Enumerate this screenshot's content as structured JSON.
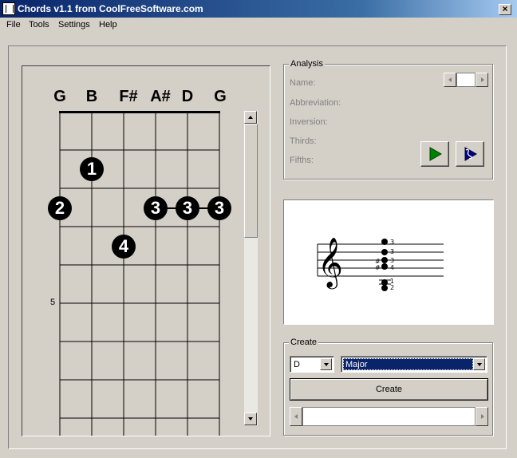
{
  "window": {
    "title": "Chords v1.1 from CoolFreeSoftware.com",
    "icon": "chord-app-icon",
    "close_glyph": "×"
  },
  "menu": [
    {
      "label": "File"
    },
    {
      "label": "Tools"
    },
    {
      "label": "Settings"
    },
    {
      "label": "Help"
    }
  ],
  "fretboard": {
    "strings": [
      "G",
      "B",
      "F#",
      "A#",
      "D",
      "G"
    ],
    "fret_marker": "5",
    "fingers": [
      {
        "string": 2,
        "fret": 2,
        "label": "1"
      },
      {
        "string": 1,
        "fret": 3,
        "label": "2"
      },
      {
        "string": 4,
        "fret": 3,
        "label": "3"
      },
      {
        "string": 5,
        "fret": 3,
        "label": "3"
      },
      {
        "string": 6,
        "fret": 3,
        "label": "3"
      },
      {
        "string": 3,
        "fret": 4,
        "label": "4"
      }
    ]
  },
  "analysis": {
    "title": "Analysis",
    "labels": [
      "Name:",
      "Abbreviation:",
      "Inversion:",
      "Thirds:",
      "Fifths:"
    ],
    "play_icon": "play-icon",
    "arpeggio_icon": "arpeggio-play-icon"
  },
  "staff": {
    "clef": "𝄞",
    "notes": [
      {
        "label": "3",
        "sharp": ""
      },
      {
        "label": "3",
        "sharp": ""
      },
      {
        "label": "3",
        "sharp": "#"
      },
      {
        "label": "4",
        "sharp": "#"
      },
      {
        "label": "1",
        "sharp": ""
      },
      {
        "label": "2",
        "sharp": ""
      }
    ]
  },
  "create": {
    "title": "Create",
    "root_value": "D",
    "type_value": "Major",
    "button_label": "Create"
  },
  "colors": {
    "window_bg": "#d4d0c8",
    "titlebar_start": "#0a246a",
    "selection": "#0a246a",
    "play_green": "#008000",
    "arpeggio_blue": "#000080"
  }
}
